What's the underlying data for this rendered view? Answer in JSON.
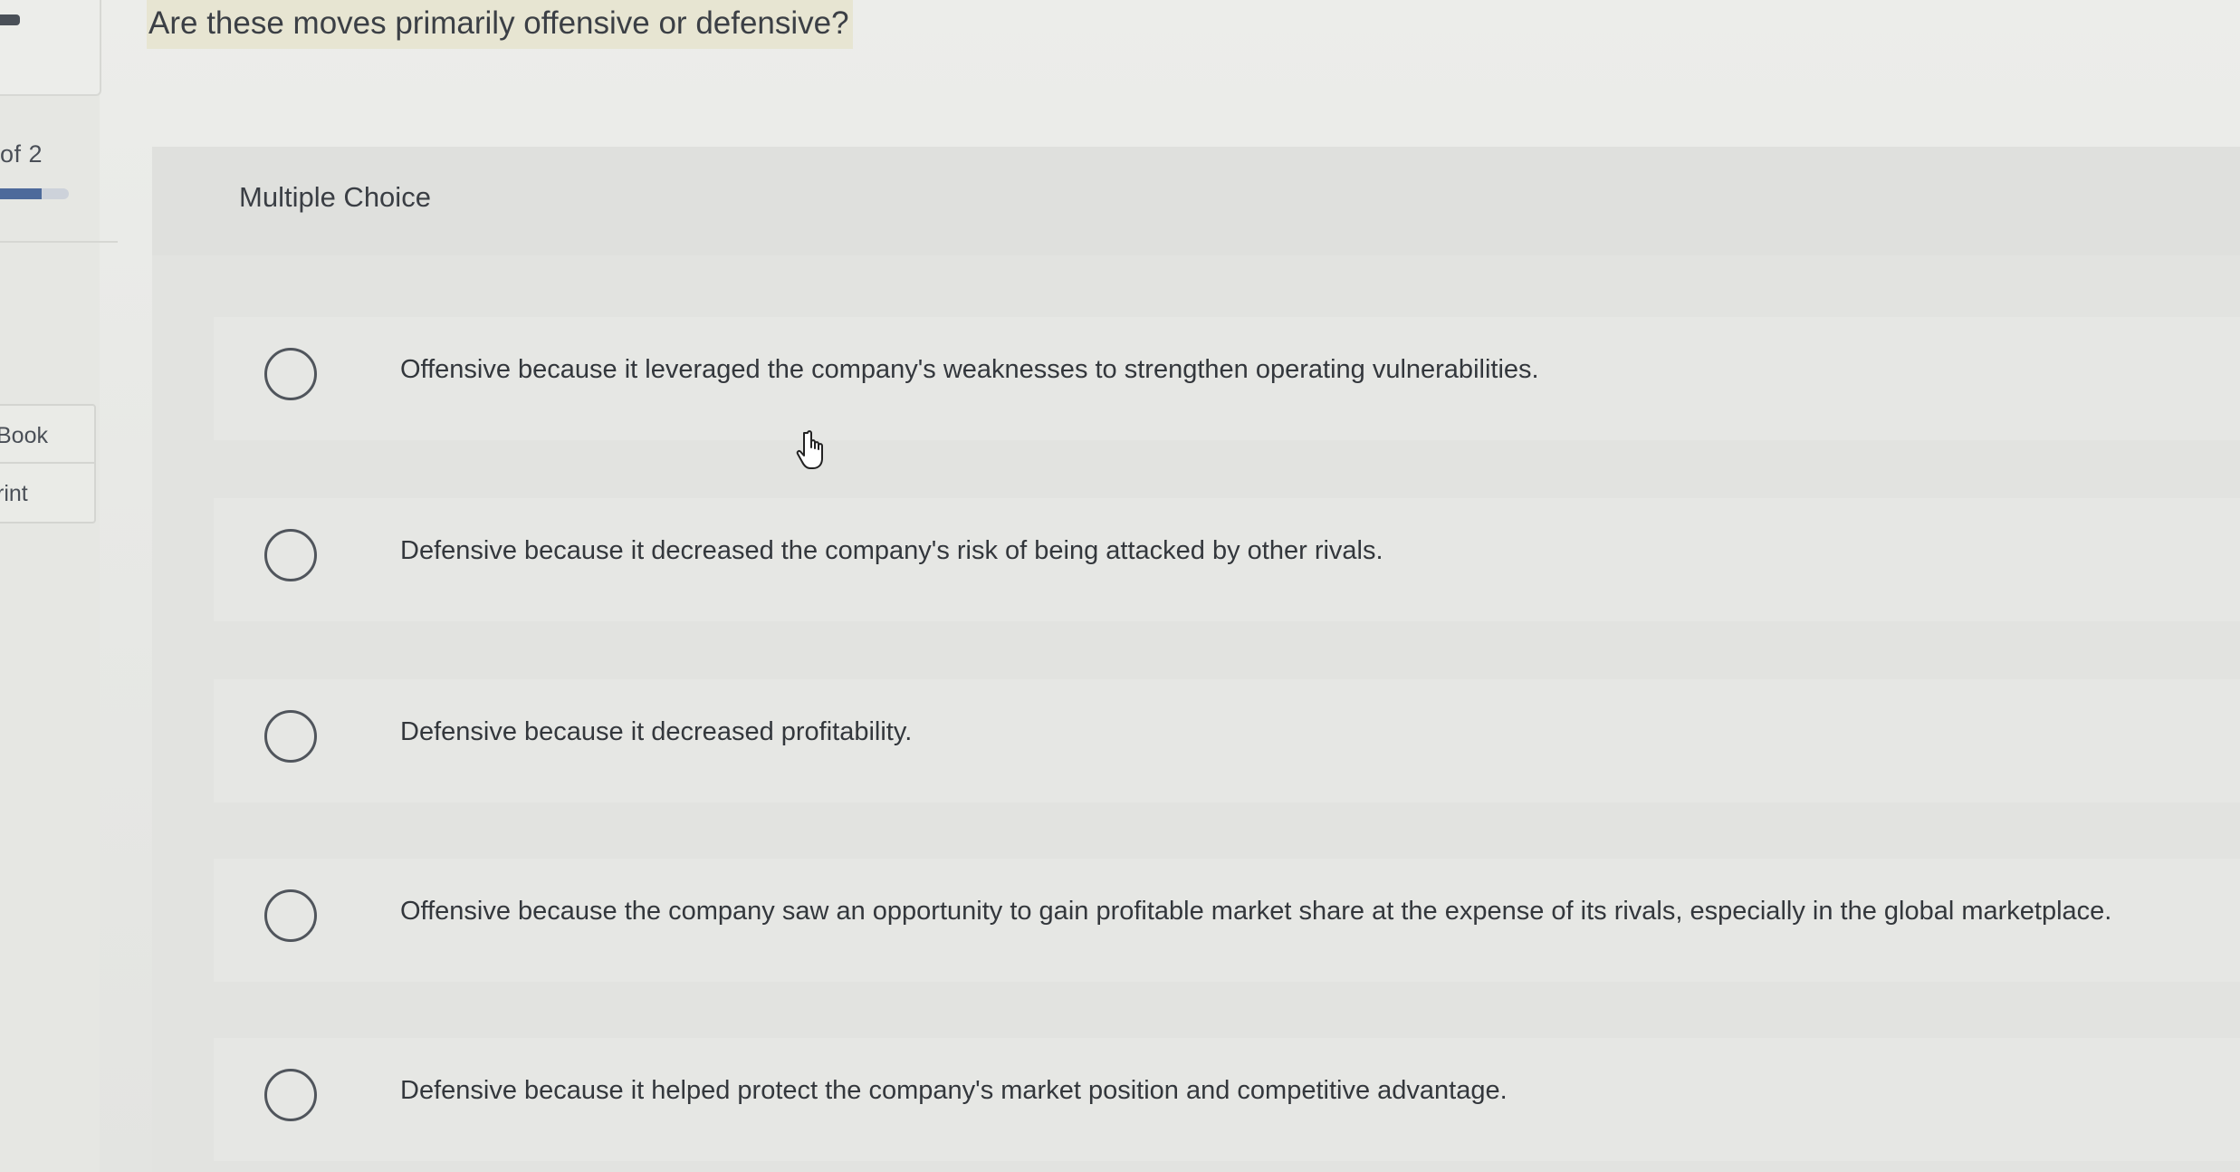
{
  "sidebar": {
    "counter": "of 2",
    "progress_fraction": 0.6,
    "ebook_label": "Book",
    "print_label": "rint"
  },
  "question": {
    "text": "Are these moves primarily offensive or defensive?"
  },
  "answer_panel": {
    "type_label": "Multiple Choice",
    "options": [
      {
        "label": "Offensive because it leveraged the company's weaknesses to strengthen operating vulnerabilities."
      },
      {
        "label": "Defensive because it decreased the company's risk of being attacked by other rivals."
      },
      {
        "label": "Defensive because it decreased profitability."
      },
      {
        "label": "Offensive because the company saw an opportunity to gain profitable market share at the expense of its rivals, especially in the global marketplace."
      },
      {
        "label": "Defensive because it helped protect the company's market position and competitive advantage."
      }
    ]
  },
  "cursor_icon": "hand-pointer-icon"
}
